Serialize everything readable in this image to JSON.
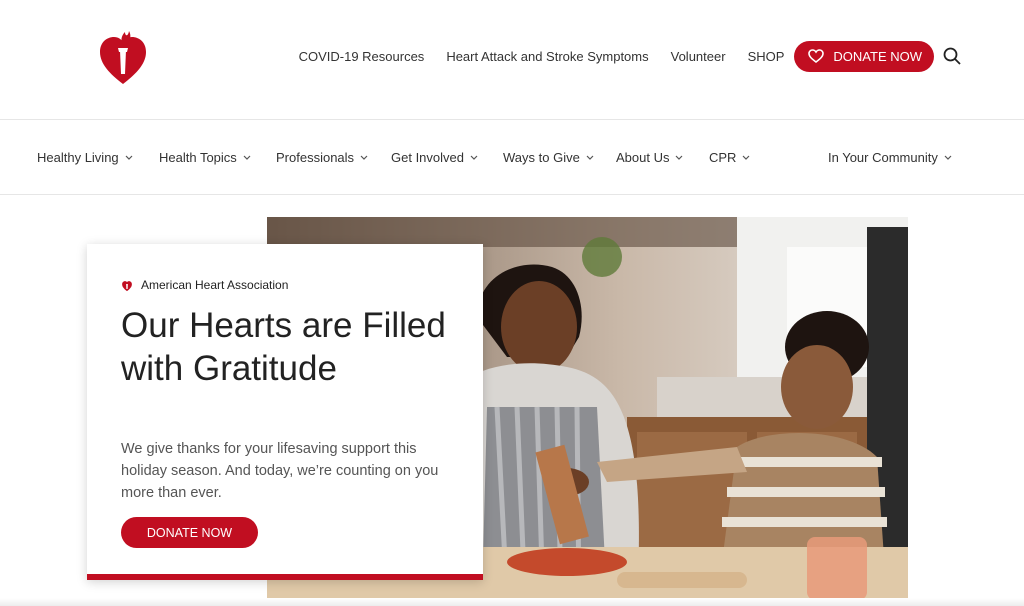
{
  "header": {
    "logo_icon": "heart-torch-logo-icon",
    "top_links": [
      "COVID-19 Resources",
      "Heart Attack and Stroke Symptoms",
      "Volunteer",
      "SHOP"
    ],
    "donate_label": "DONATE NOW",
    "donate_icon": "heart-outline-icon",
    "search_icon": "search-icon"
  },
  "nav": {
    "items": [
      "Healthy Living",
      "Health Topics",
      "Professionals",
      "Get Involved",
      "Ways to Give",
      "About Us",
      "CPR"
    ],
    "community": "In Your Community",
    "chevron_icon": "chevron-down-icon"
  },
  "hero": {
    "brand": "American Heart Association",
    "title": "Our Hearts are Filled with Gratitude",
    "text": "We give thanks for your lifesaving support this holiday season. And today, we’re counting on you more than ever.",
    "button": "DONATE NOW"
  },
  "colors": {
    "brand_red": "#c10e21",
    "text_dark": "#222222",
    "text_muted": "#555555"
  }
}
